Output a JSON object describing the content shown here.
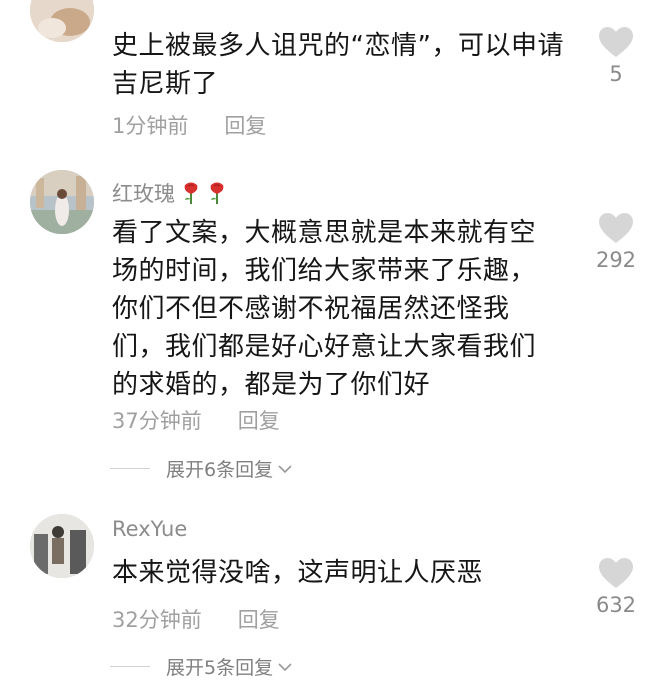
{
  "comments": [
    {
      "username": "",
      "text": "史上被最多人诅咒的“恋情”，可以申请吉尼斯了",
      "time": "1分钟前",
      "reply": "回复",
      "likes": "5"
    },
    {
      "username": "红玫瑰",
      "text": "看了文案，大概意思就是本来就有空场的时间，我们给大家带来了乐趣，你们不但不感谢不祝福居然还怪我们，我们都是好心好意让大家看我们的求婚的，都是为了你们好",
      "time": "37分钟前",
      "reply": "回复",
      "likes": "292",
      "expand": "展开6条回复"
    },
    {
      "username": "RexYue",
      "text": "本来觉得没啥，这声明让人厌恶",
      "time": "32分钟前",
      "reply": "回复",
      "likes": "632",
      "expand": "展开5条回复"
    }
  ],
  "icons": {
    "like": "heart-icon",
    "expand": "chevron-down-icon",
    "rose": "rose-emoji-icon"
  },
  "colors": {
    "text": "#161616",
    "muted": "#a0a0a0",
    "heart": "#d6d6d6"
  }
}
